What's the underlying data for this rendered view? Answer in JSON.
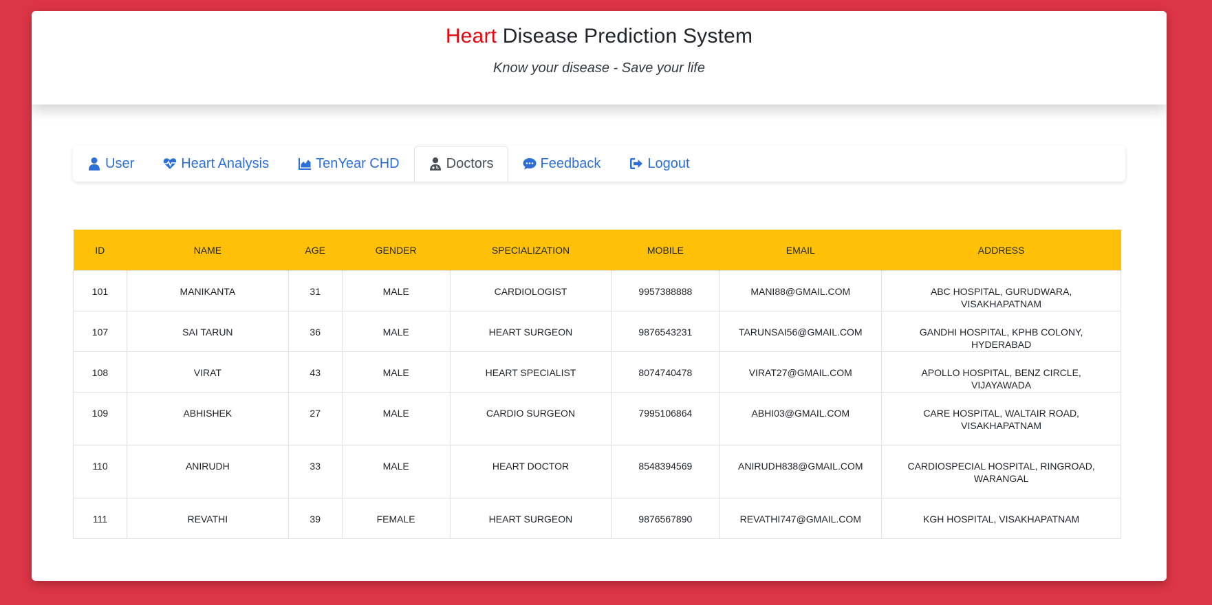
{
  "header": {
    "title_accent": "Heart",
    "title_rest": " Disease Prediction System",
    "subtitle": "Know your disease - Save your life"
  },
  "tabs": [
    {
      "label": "User",
      "icon": "user-icon",
      "active": false
    },
    {
      "label": "Heart Analysis",
      "icon": "heartbeat-icon",
      "active": false
    },
    {
      "label": "TenYear CHD",
      "icon": "area-chart-icon",
      "active": false
    },
    {
      "label": "Doctors",
      "icon": "doctor-icon",
      "active": true
    },
    {
      "label": "Feedback",
      "icon": "comments-icon",
      "active": false
    },
    {
      "label": "Logout",
      "icon": "logout-icon",
      "active": false
    }
  ],
  "table": {
    "columns": [
      "ID",
      "NAME",
      "AGE",
      "GENDER",
      "SPECIALIZATION",
      "MOBILE",
      "EMAIL",
      "ADDRESS"
    ],
    "rows": [
      [
        "101",
        "MANIKANTA",
        "31",
        "MALE",
        "CARDIOLOGIST",
        "9957388888",
        "MANI88@GMAIL.COM",
        "ABC HOSPITAL, GURUDWARA, VISAKHAPATNAM"
      ],
      [
        "107",
        "SAI TARUN",
        "36",
        "MALE",
        "HEART SURGEON",
        "9876543231",
        "TARUNSAI56@GMAIL.COM",
        "GANDHI HOSPITAL, KPHB COLONY, HYDERABAD"
      ],
      [
        "108",
        "VIRAT",
        "43",
        "MALE",
        "HEART SPECIALIST",
        "8074740478",
        "VIRAT27@GMAIL.COM",
        "APOLLO HOSPITAL, BENZ CIRCLE, VIJAYAWADA"
      ],
      [
        "109",
        "ABHISHEK",
        "27",
        "MALE",
        "CARDIO SURGEON",
        "7995106864",
        "ABHI03@GMAIL.COM",
        "CARE HOSPITAL, WALTAIR ROAD, VISAKHAPATNAM"
      ],
      [
        "110",
        "ANIRUDH",
        "33",
        "MALE",
        "HEART DOCTOR",
        "8548394569",
        "ANIRUDH838@GMAIL.COM",
        "CARDIOSPECIAL HOSPITAL, RINGROAD, WARANGAL"
      ],
      [
        "111",
        "REVATHI",
        "39",
        "FEMALE",
        "HEART SURGEON",
        "9876567890",
        "REVATHI747@GMAIL.COM",
        "KGH HOSPITAL, VISAKHAPATNAM"
      ]
    ]
  },
  "colors": {
    "page_background": "#dc3545",
    "accent_red": "#e3070f",
    "header_row": "#ffc107",
    "link_blue": "#2c6fd6"
  }
}
